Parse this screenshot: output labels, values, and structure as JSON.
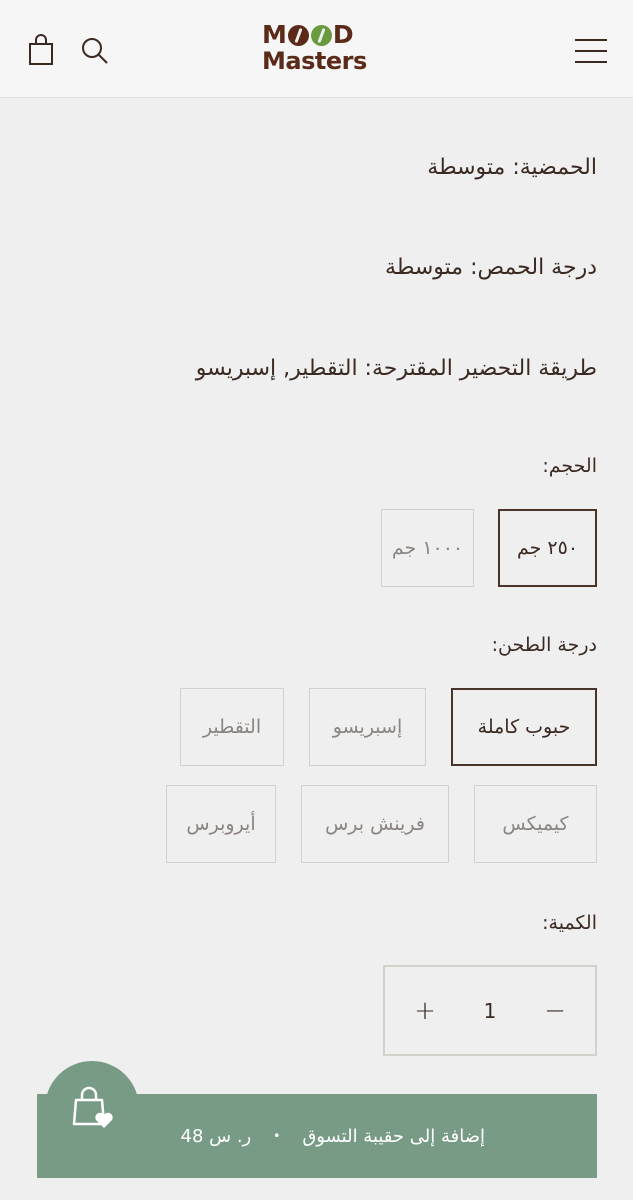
{
  "header": {
    "brand_line1_prefix": "M",
    "brand_line1_suffix": "D",
    "brand_line2": "Masters",
    "icons": [
      "menu-icon",
      "search-icon",
      "cart-icon"
    ]
  },
  "specs": {
    "acidity": "الحمضية: متوسطة",
    "roast_level": "درجة الحمص: متوسطة",
    "brew_method": "طريقة التحضير المقترحة: التقطير, إسبريسو"
  },
  "size": {
    "label": "الحجم:",
    "options": [
      "٢٥٠ جم",
      "١٠٠٠ جم"
    ],
    "selected": "٢٥٠ جم"
  },
  "grind": {
    "label": "درجة الطحن:",
    "options": [
      "حبوب كاملة",
      "إسبريسو",
      "التقطير",
      "كيميكس",
      "فرينش برس",
      "أيروبرس"
    ],
    "selected": "حبوب كاملة"
  },
  "quantity": {
    "label": "الكمية:",
    "minus": "−",
    "value": "1",
    "plus": "+"
  },
  "cart": {
    "label": "إضافة إلى حقيبة التسوق",
    "separator": "•",
    "price": "48 ر. س"
  },
  "colors": {
    "accent_green": "#779b85",
    "brand_brown": "#5b2a18",
    "bean_green": "#6a9a3e",
    "background": "#efefef"
  }
}
